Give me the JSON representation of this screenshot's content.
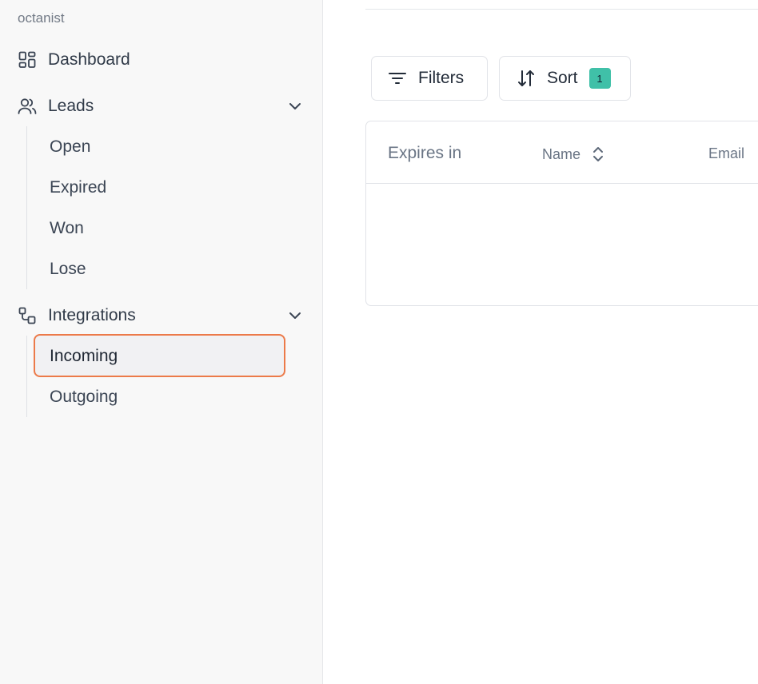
{
  "sidebar": {
    "brand": "octanist",
    "items": [
      {
        "label": "Dashboard",
        "icon": "dashboard-grid-icon"
      },
      {
        "label": "Leads",
        "icon": "users-icon",
        "expanded": true,
        "children": [
          "Open",
          "Expired",
          "Won",
          "Lose"
        ]
      },
      {
        "label": "Integrations",
        "icon": "integrations-icon",
        "expanded": true,
        "children": [
          "Incoming",
          "Outgoing"
        ],
        "active_child": "Incoming"
      }
    ]
  },
  "toolbar": {
    "filters_label": "Filters",
    "sort_label": "Sort",
    "sort_count": "1"
  },
  "table": {
    "columns": [
      "Expires in",
      "Name",
      "Email"
    ],
    "rows": []
  },
  "colors": {
    "active_outline": "#ec7a49",
    "badge": "#40c0a8",
    "sidebar_bg": "#f8f8f8"
  }
}
